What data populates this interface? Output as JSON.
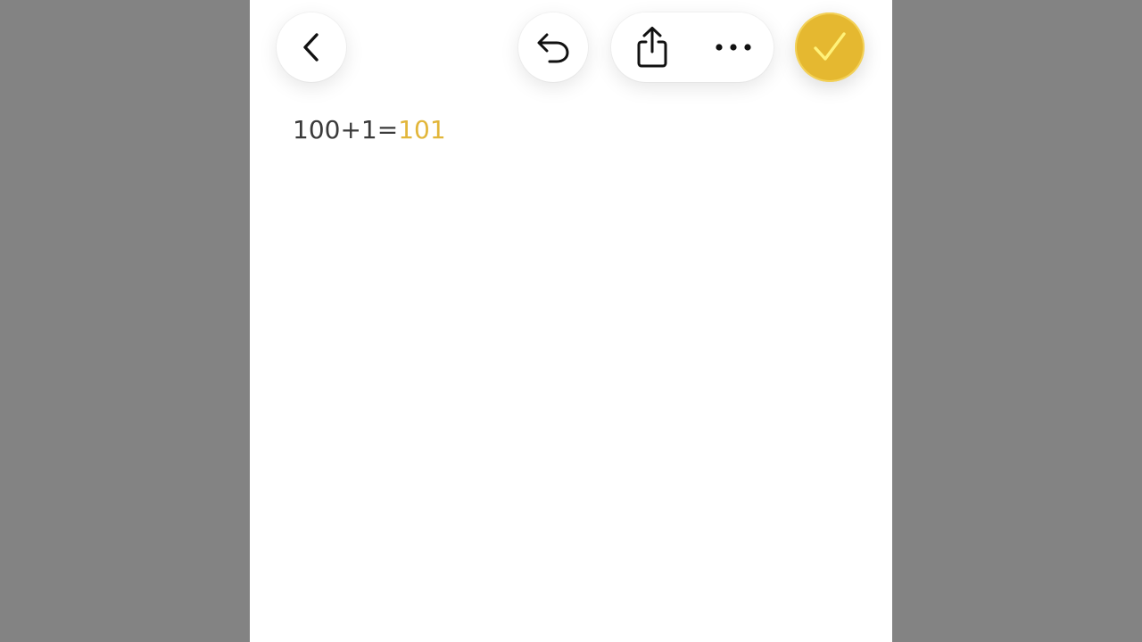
{
  "toolbar": {
    "back_icon": "chevron-left-icon",
    "undo_icon": "undo-arrow-icon",
    "share_icon": "share-icon",
    "more_icon": "ellipsis-icon",
    "done_icon": "checkmark-icon"
  },
  "note": {
    "expression": "100+1=",
    "result": "101"
  },
  "colors": {
    "accent": "#e5b830",
    "result_text": "#e2b63a",
    "text": "#3a3a3a",
    "background": "#ffffff",
    "outside": "#838383"
  }
}
